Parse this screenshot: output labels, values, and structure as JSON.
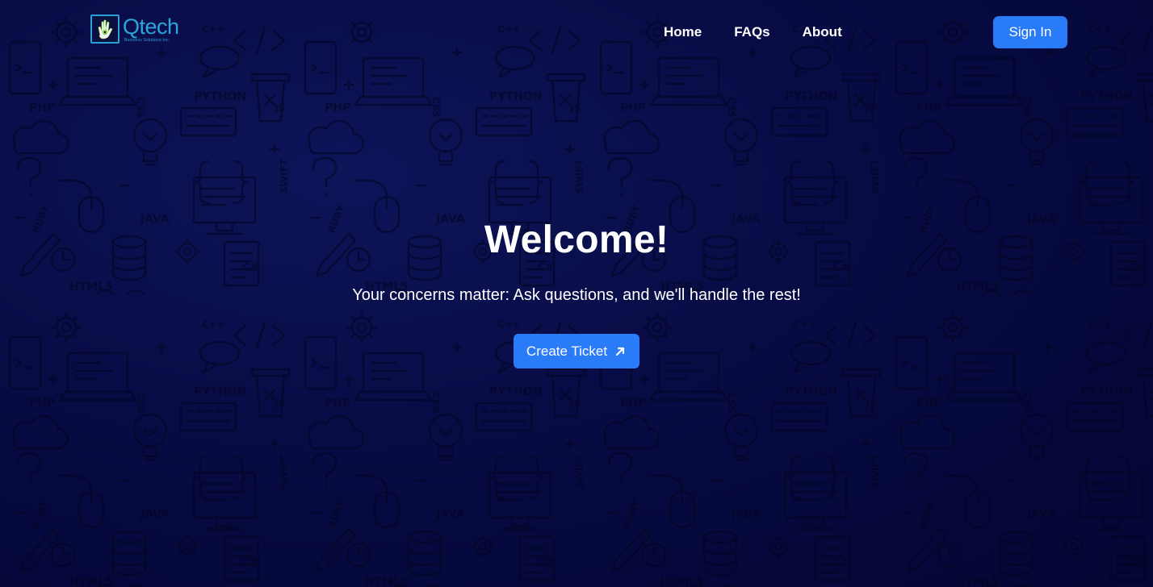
{
  "brand": {
    "name": "Qtech",
    "tagline": "Business Solutions Inc."
  },
  "nav": {
    "items": [
      {
        "label": "Home"
      },
      {
        "label": "FAQs"
      },
      {
        "label": "About"
      }
    ],
    "signin_label": "Sign In"
  },
  "hero": {
    "title": "Welcome!",
    "subtitle": "Your concerns matter: Ask questions, and we'll handle the rest!",
    "cta_label": "Create Ticket",
    "cta_icon": "arrow-up-right-icon"
  },
  "background": {
    "pattern_words": [
      "PYTHON",
      "PHP",
      "JAVA",
      "RUBY",
      "SWIFT",
      "HTML5",
      "CSS",
      "JS",
      "C#",
      "C++"
    ]
  },
  "colors": {
    "accent": "#2a7bf7",
    "brand": "#2aa6dc",
    "background": "#06083a"
  }
}
